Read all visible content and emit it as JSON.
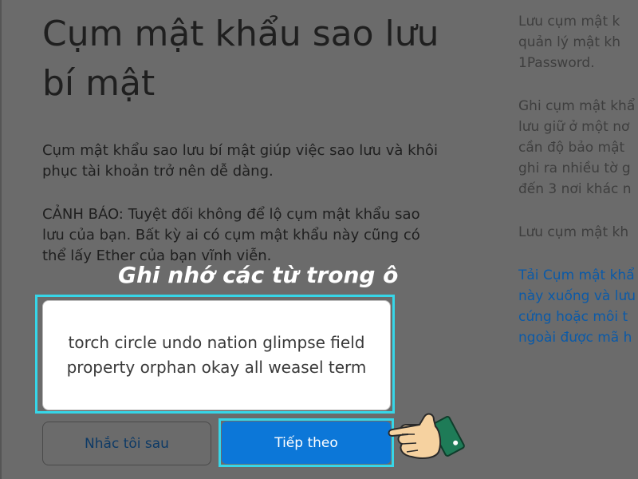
{
  "page": {
    "title": "Cụm mật khẩu sao lưu bí mật",
    "intro": "Cụm mật khẩu sao lưu bí mật giúp việc sao lưu và khôi phục tài khoản trở nên dễ dàng.",
    "warning": "CẢNH BÁO: Tuyệt đối không để lộ cụm mật khẩu sao lưu của bạn. Bất kỳ ai có cụm mật khẩu này cũng có thể lấy Ether của bạn vĩnh viễn."
  },
  "annotation": {
    "label": "Ghi nhớ các từ trong ô"
  },
  "phrase": {
    "words": "torch circle undo nation glimpse field property orphan okay all weasel term"
  },
  "buttons": {
    "remind_later": "Nhắc tôi sau",
    "next": "Tiếp theo"
  },
  "tips": [
    {
      "line1": "Lưu cụm mật k",
      "line2": "quản lý mật kh",
      "line3": "1Password."
    },
    {
      "line1": "Ghi cụm mật khẩ",
      "line2": "lưu giữ ở một nơ",
      "line3": "cần độ bảo mật",
      "line4": "ghi ra nhiều tờ g",
      "line5": "đến 3 nơi khác n"
    },
    {
      "line1": "Lưu cụm mật kh"
    },
    {
      "line1": "Tải Cụm mật khẩ",
      "line2": "này xuống và lưu",
      "line3": "cứng hoặc môi t",
      "line4": "ngoài được mã h"
    }
  ],
  "colors": {
    "primary_button": "#0c77d8",
    "highlight_border": "#36d6e8",
    "link": "#0b5aa8",
    "overlay": "#6b6b6b"
  },
  "icons": {
    "pointer": "pointing-hand-icon"
  }
}
